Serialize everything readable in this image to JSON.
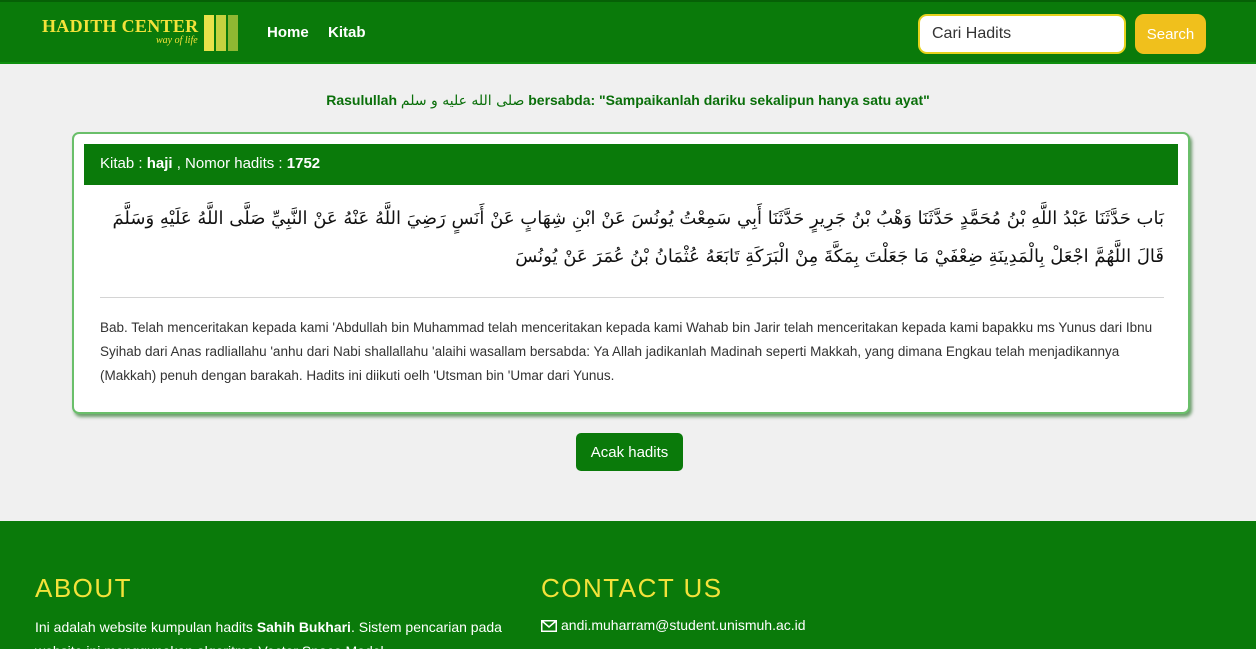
{
  "navbar": {
    "brand_name": "HADITH CENTER",
    "brand_tagline": "way of life",
    "links": [
      "Home",
      "Kitab"
    ],
    "search_placeholder": "Cari Hadits",
    "search_button": "Search"
  },
  "quote": {
    "prefix": "Rasulullah",
    "arabic": "صلى الله عليه و سلم",
    "suffix": "bersabda: \"Sampaikanlah dariku sekalipun hanya satu ayat\""
  },
  "hadith": {
    "kitab_label": "Kitab :",
    "kitab_value": "haji",
    "nomor_label": ", Nomor hadits :",
    "nomor_value": "1752",
    "arabic_text": "بَاب حَدَّثَنَا عَبْدُ اللَّهِ بْنُ مُحَمَّدٍ حَدَّثَنَا وَهْبُ بْنُ جَرِيرٍ حَدَّثَنَا أَبِي سَمِعْتُ يُونُسَ عَنْ ابْنِ شِهَابٍ عَنْ أَنَسٍ رَضِيَ اللَّهُ عَنْهُ عَنْ النَّبِيِّ صَلَّى اللَّهُ عَلَيْهِ وَسَلَّمَ قَالَ اللَّهُمَّ اجْعَلْ بِالْمَدِينَةِ ضِعْفَيْ مَا جَعَلْتَ بِمَكَّةَ مِنْ الْبَرَكَةِ تَابَعَهُ عُثْمَانُ بْنُ عُمَرَ عَنْ يُونُسَ",
    "translation": "Bab. Telah menceritakan kepada kami 'Abdullah bin Muhammad telah menceritakan kepada kami Wahab bin Jarir telah menceritakan kepada kami bapakku ms Yunus dari Ibnu Syihab dari Anas radliallahu 'anhu dari Nabi shallallahu 'alaihi wasallam bersabda: Ya Allah jadikanlah Madinah seperti Makkah, yang dimana Engkau telah menjadikannya (Makkah) penuh dengan barakah. Hadits ini diikuti oelh 'Utsman bin 'Umar dari Yunus."
  },
  "acak_button": "Acak hadits",
  "footer": {
    "about_heading": "ABOUT",
    "about_text_1": "Ini adalah website kumpulan hadits ",
    "about_bold": "Sahih Bukhari",
    "about_text_2": ". Sistem pencarian pada website ini menggunakan algoritma Vector Space Model.",
    "contact_heading": "CONTACT US",
    "contact_email": "andi.muharram@student.unismuh.ac.id"
  },
  "colors": {
    "primary_green": "#0a7a0a",
    "accent_yellow": "#f3e23a",
    "button_yellow": "#f0c01c",
    "background": "#f0f0f0"
  },
  "icons": [
    "mail-icon"
  ]
}
